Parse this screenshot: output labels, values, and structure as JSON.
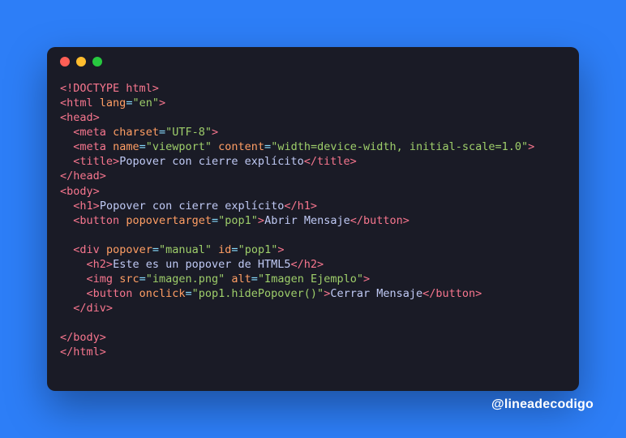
{
  "window": {
    "dots": {
      "red": "#ff5f56",
      "yellow": "#ffbd2e",
      "green": "#27c93f"
    }
  },
  "code": {
    "l1": {
      "doctype": "<!DOCTYPE html>"
    },
    "l2": {
      "open": "<",
      "tag": "html",
      "sp": " ",
      "attr": "lang",
      "eq": "=",
      "val": "\"en\"",
      "close": ">"
    },
    "l3": {
      "open": "<",
      "tag": "head",
      "close": ">"
    },
    "l4": {
      "indent": "  ",
      "open": "<",
      "tag": "meta",
      "sp": " ",
      "attr": "charset",
      "eq": "=",
      "val": "\"UTF-8\"",
      "close": ">"
    },
    "l5": {
      "indent": "  ",
      "open": "<",
      "tag": "meta",
      "sp1": " ",
      "attr1": "name",
      "eq1": "=",
      "val1": "\"viewport\"",
      "sp2": " ",
      "attr2": "content",
      "eq2": "=",
      "val2": "\"width=device-width, initial-scale=1.0\"",
      "close": ">"
    },
    "l6": {
      "indent": "  ",
      "open": "<",
      "tag": "title",
      "close": ">",
      "text": "Popover con cierre explícito",
      "copen": "</",
      "ctag": "title",
      "cclose": ">"
    },
    "l7": {
      "open": "</",
      "tag": "head",
      "close": ">"
    },
    "l8": {
      "open": "<",
      "tag": "body",
      "close": ">"
    },
    "l9": {
      "indent": "  ",
      "open": "<",
      "tag": "h1",
      "close": ">",
      "text": "Popover con cierre explícito",
      "copen": "</",
      "ctag": "h1",
      "cclose": ">"
    },
    "l10": {
      "indent": "  ",
      "open": "<",
      "tag": "button",
      "sp": " ",
      "attr": "popovertarget",
      "eq": "=",
      "val": "\"pop1\"",
      "close": ">",
      "text": "Abrir Mensaje",
      "copen": "</",
      "ctag": "button",
      "cclose": ">"
    },
    "blank1": "",
    "l11": {
      "indent": "  ",
      "open": "<",
      "tag": "div",
      "sp1": " ",
      "attr1": "popover",
      "eq1": "=",
      "val1": "\"manual\"",
      "sp2": " ",
      "attr2": "id",
      "eq2": "=",
      "val2": "\"pop1\"",
      "close": ">"
    },
    "l12": {
      "indent": "    ",
      "open": "<",
      "tag": "h2",
      "close": ">",
      "text": "Este es un popover de HTML5",
      "copen": "</",
      "ctag": "h2",
      "cclose": ">"
    },
    "l13": {
      "indent": "    ",
      "open": "<",
      "tag": "img",
      "sp1": " ",
      "attr1": "src",
      "eq1": "=",
      "val1": "\"imagen.png\"",
      "sp2": " ",
      "attr2": "alt",
      "eq2": "=",
      "val2": "\"Imagen Ejemplo\"",
      "close": ">"
    },
    "l14": {
      "indent": "    ",
      "open": "<",
      "tag": "button",
      "sp": " ",
      "attr": "onclick",
      "eq": "=",
      "val": "\"pop1.hidePopover()\"",
      "close": ">",
      "text": "Cerrar Mensaje",
      "copen": "</",
      "ctag": "button",
      "cclose": ">"
    },
    "l15": {
      "indent": "  ",
      "open": "</",
      "tag": "div",
      "close": ">"
    },
    "blank2": "",
    "l16": {
      "open": "</",
      "tag": "body",
      "close": ">"
    },
    "l17": {
      "open": "</",
      "tag": "html",
      "close": ">"
    }
  },
  "watermark": "@lineadecodigo"
}
